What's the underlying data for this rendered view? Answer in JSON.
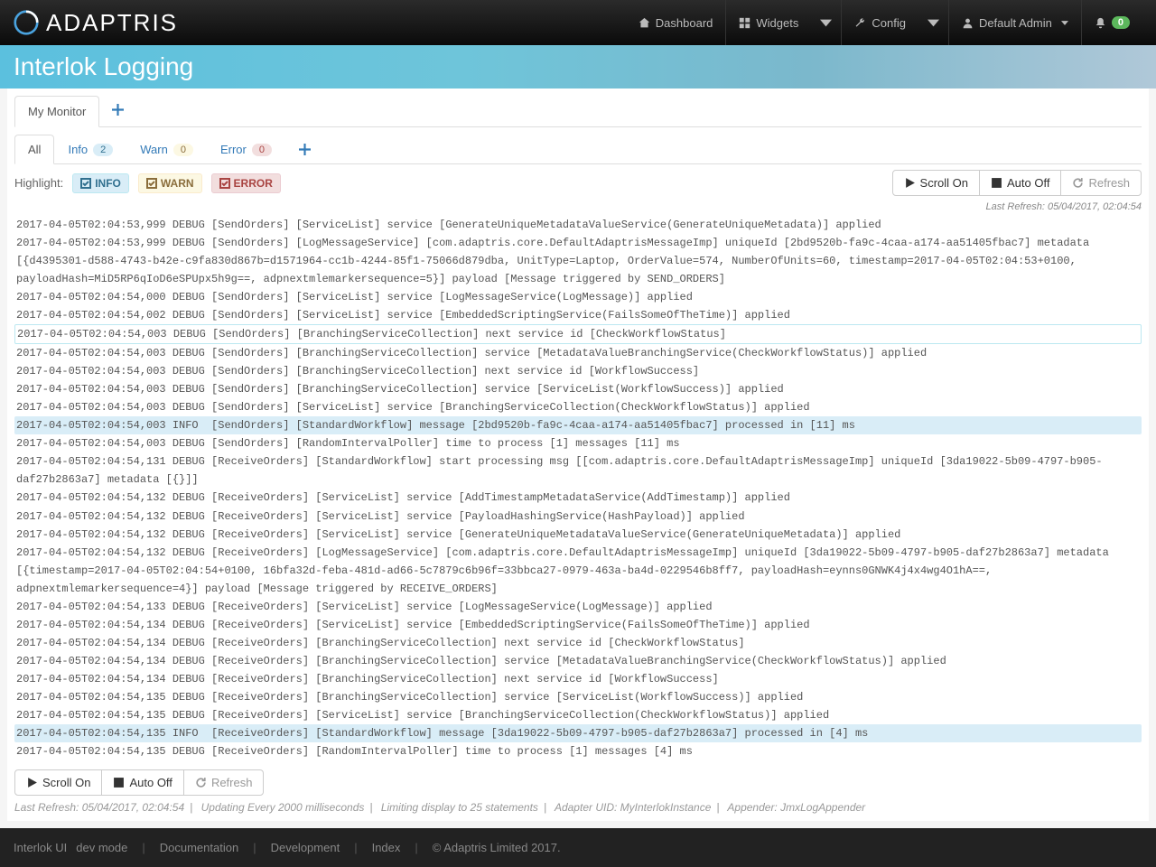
{
  "brand": "ADAPTRIS",
  "nav": {
    "dashboard": "Dashboard",
    "widgets": "Widgets",
    "config": "Config",
    "user": "Default Admin",
    "notif_count": "0"
  },
  "page_title": "Interlok Logging",
  "monitor_tabs": {
    "my_monitor": "My Monitor"
  },
  "filter_tabs": {
    "all": "All",
    "info": "Info",
    "info_count": "2",
    "warn": "Warn",
    "warn_count": "0",
    "error": "Error",
    "error_count": "0"
  },
  "highlight": {
    "label": "Highlight:",
    "info": "INFO",
    "warn": "WARN",
    "error": "ERROR"
  },
  "buttons": {
    "scroll_on": "Scroll On",
    "auto_off": "Auto Off",
    "refresh": "Refresh"
  },
  "last_refresh_top": "Last Refresh: 05/04/2017, 02:04:54",
  "logs": [
    {
      "t": "2017-04-05T02:04:53,999 DEBUG [SendOrders] [ServiceList] service [GenerateUniqueMetadataValueService(GenerateUniqueMetadata)] applied"
    },
    {
      "t": "2017-04-05T02:04:53,999 DEBUG [SendOrders] [LogMessageService] [com.adaptris.core.DefaultAdaptrisMessageImp] uniqueId [2bd9520b-fa9c-4caa-a174-aa51405fbac7] metadata [{d4395301-d588-4743-b42e-c9fa830d867b=d1571964-cc1b-4244-85f1-75066d879dba, UnitType=Laptop, OrderValue=574, NumberOfUnits=60, timestamp=2017-04-05T02:04:53+0100, payloadHash=MiD5RP6qIoD6eSPUpx5h9g==, adpnextmlemarkersequence=5}] payload [Message triggered by SEND_ORDERS]"
    },
    {
      "t": "2017-04-05T02:04:54,000 DEBUG [SendOrders] [ServiceList] service [LogMessageService(LogMessage)] applied"
    },
    {
      "t": "2017-04-05T02:04:54,002 DEBUG [SendOrders] [ServiceList] service [EmbeddedScriptingService(FailsSomeOfTheTime)] applied"
    },
    {
      "t": "2017-04-05T02:04:54,003 DEBUG [SendOrders] [BranchingServiceCollection] next service id [CheckWorkflowStatus]",
      "cls": "hl-box"
    },
    {
      "t": "2017-04-05T02:04:54,003 DEBUG [SendOrders] [BranchingServiceCollection] service [MetadataValueBranchingService(CheckWorkflowStatus)] applied"
    },
    {
      "t": "2017-04-05T02:04:54,003 DEBUG [SendOrders] [BranchingServiceCollection] next service id [WorkflowSuccess]"
    },
    {
      "t": "2017-04-05T02:04:54,003 DEBUG [SendOrders] [BranchingServiceCollection] service [ServiceList(WorkflowSuccess)] applied"
    },
    {
      "t": "2017-04-05T02:04:54,003 DEBUG [SendOrders] [ServiceList] service [BranchingServiceCollection(CheckWorkflowStatus)] applied"
    },
    {
      "t": "2017-04-05T02:04:54,003 INFO  [SendOrders] [StandardWorkflow] message [2bd9520b-fa9c-4caa-a174-aa51405fbac7] processed in [11] ms",
      "cls": "hl-info"
    },
    {
      "t": "2017-04-05T02:04:54,003 DEBUG [SendOrders] [RandomIntervalPoller] time to process [1] messages [11] ms"
    },
    {
      "t": "2017-04-05T02:04:54,131 DEBUG [ReceiveOrders] [StandardWorkflow] start processing msg [[com.adaptris.core.DefaultAdaptrisMessageImp] uniqueId [3da19022-5b09-4797-b905-daf27b2863a7] metadata [{}]]"
    },
    {
      "t": "2017-04-05T02:04:54,132 DEBUG [ReceiveOrders] [ServiceList] service [AddTimestampMetadataService(AddTimestamp)] applied"
    },
    {
      "t": "2017-04-05T02:04:54,132 DEBUG [ReceiveOrders] [ServiceList] service [PayloadHashingService(HashPayload)] applied"
    },
    {
      "t": "2017-04-05T02:04:54,132 DEBUG [ReceiveOrders] [ServiceList] service [GenerateUniqueMetadataValueService(GenerateUniqueMetadata)] applied"
    },
    {
      "t": "2017-04-05T02:04:54,132 DEBUG [ReceiveOrders] [LogMessageService] [com.adaptris.core.DefaultAdaptrisMessageImp] uniqueId [3da19022-5b09-4797-b905-daf27b2863a7] metadata [{timestamp=2017-04-05T02:04:54+0100, 16bfa32d-feba-481d-ad66-5c7879c6b96f=33bbca27-0979-463a-ba4d-0229546b8ff7, payloadHash=eynns0GNWK4j4x4wg4O1hA==, adpnextmlemarkersequence=4}] payload [Message triggered by RECEIVE_ORDERS]"
    },
    {
      "t": "2017-04-05T02:04:54,133 DEBUG [ReceiveOrders] [ServiceList] service [LogMessageService(LogMessage)] applied"
    },
    {
      "t": "2017-04-05T02:04:54,134 DEBUG [ReceiveOrders] [ServiceList] service [EmbeddedScriptingService(FailsSomeOfTheTime)] applied"
    },
    {
      "t": "2017-04-05T02:04:54,134 DEBUG [ReceiveOrders] [BranchingServiceCollection] next service id [CheckWorkflowStatus]"
    },
    {
      "t": "2017-04-05T02:04:54,134 DEBUG [ReceiveOrders] [BranchingServiceCollection] service [MetadataValueBranchingService(CheckWorkflowStatus)] applied"
    },
    {
      "t": "2017-04-05T02:04:54,134 DEBUG [ReceiveOrders] [BranchingServiceCollection] next service id [WorkflowSuccess]"
    },
    {
      "t": "2017-04-05T02:04:54,135 DEBUG [ReceiveOrders] [BranchingServiceCollection] service [ServiceList(WorkflowSuccess)] applied"
    },
    {
      "t": "2017-04-05T02:04:54,135 DEBUG [ReceiveOrders] [ServiceList] service [BranchingServiceCollection(CheckWorkflowStatus)] applied"
    },
    {
      "t": "2017-04-05T02:04:54,135 INFO  [ReceiveOrders] [StandardWorkflow] message [3da19022-5b09-4797-b905-daf27b2863a7] processed in [4] ms",
      "cls": "hl-info"
    },
    {
      "t": "2017-04-05T02:04:54,135 DEBUG [ReceiveOrders] [RandomIntervalPoller] time to process [1] messages [4] ms"
    }
  ],
  "status": {
    "last_refresh": "Last Refresh: 05/04/2017, 02:04:54",
    "updating": "Updating Every 2000 milliseconds",
    "limiting": "Limiting display to 25 statements",
    "adapter_uid": "Adapter UID: MyInterlokInstance",
    "appender": "Appender: JmxLogAppender"
  },
  "footer": {
    "app": "Interlok UI",
    "mode": "dev mode",
    "documentation": "Documentation",
    "development": "Development",
    "index": "Index",
    "copyright": "© Adaptris Limited 2017."
  }
}
